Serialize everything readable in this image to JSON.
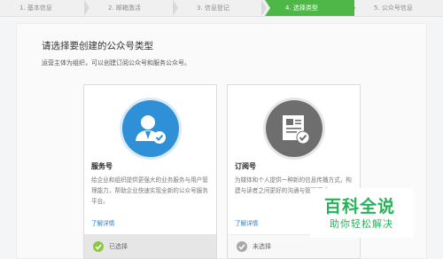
{
  "steps": [
    {
      "label": "1. 基本信息"
    },
    {
      "label": "2. 邮箱激活"
    },
    {
      "label": "3. 信息登记"
    },
    {
      "label": "4. 选择类型"
    },
    {
      "label": "5. 公众号信息"
    }
  ],
  "page": {
    "title": "请选择要创建的公众号类型",
    "subtitle": "运营主体为组织，可以创建订阅公众号和服务公众号。"
  },
  "cards": {
    "service": {
      "name": "服务号",
      "desc": "给企业和组织提供更强大的业务服务与用户管理能力，帮助企业快速实现全新的公众号服务平台。",
      "learn_more": "了解详情",
      "status": "已选择",
      "selected": true
    },
    "subscribe": {
      "name": "订阅号",
      "desc": "为媒体和个人提供一种新的信息传播方式，构建与读者之间更好的沟通与管理模式。",
      "learn_more": "了解详情",
      "status": "未选择",
      "selected": false
    }
  },
  "watermark": {
    "main": "百科全说",
    "sub": "助你轻松解决"
  },
  "colors": {
    "active_step": "#4eb748",
    "service_icon": "#2f8fd7",
    "subscribe_icon": "#6e6e6e",
    "link": "#2f7dc8",
    "watermark": "#25b35a"
  }
}
